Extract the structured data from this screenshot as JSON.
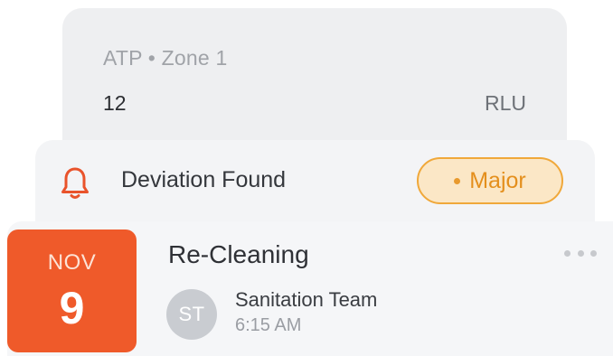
{
  "atp_card": {
    "label": "ATP • Zone 1",
    "value": "12",
    "unit": "RLU"
  },
  "deviation_card": {
    "icon": "bell-icon",
    "title": "Deviation Found",
    "severity": "Major",
    "colors": {
      "icon": "#e9532b",
      "badge_border": "#f0a83a",
      "badge_fill": "#fbe7c6",
      "badge_text": "#e48f1c"
    }
  },
  "task_card": {
    "date": {
      "month": "NOV",
      "day": "9",
      "color": "#ef5a2a"
    },
    "title": "Re-Cleaning",
    "more_icon": "more-horizontal-icon",
    "assignee": {
      "initials": "ST",
      "name": "Sanitation Team",
      "time": "6:15 AM"
    }
  }
}
